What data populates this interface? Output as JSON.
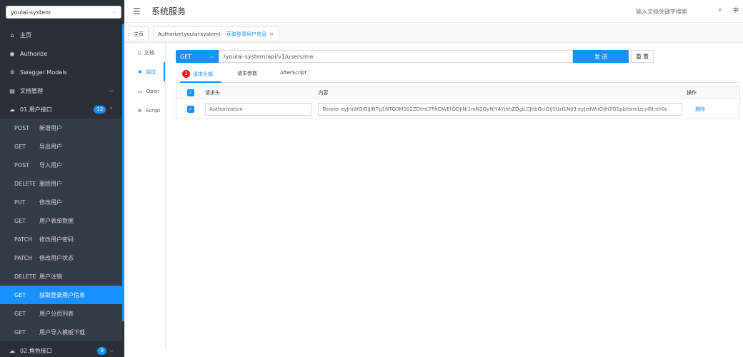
{
  "sidebar": {
    "group_select": "youlai-system",
    "menu": [
      {
        "label": "主页",
        "icon": "home-icon"
      },
      {
        "label": "Authorize",
        "icon": "lock-icon"
      },
      {
        "label": "Swagger Models",
        "icon": "gear-icon"
      },
      {
        "label": "文档管理",
        "icon": "doc-icon"
      }
    ],
    "group1": {
      "label": "01.用户接口",
      "count": "12"
    },
    "apis": [
      {
        "method": "POST",
        "name": "新增用户"
      },
      {
        "method": "GET",
        "name": "导出用户"
      },
      {
        "method": "POST",
        "name": "导入用户"
      },
      {
        "method": "DELETE",
        "name": "删除用户"
      },
      {
        "method": "PUT",
        "name": "修改用户"
      },
      {
        "method": "GET",
        "name": "用户表单数据"
      },
      {
        "method": "PATCH",
        "name": "修改用户密码"
      },
      {
        "method": "PATCH",
        "name": "修改用户状态"
      },
      {
        "method": "DELETE",
        "name": "用户注销"
      },
      {
        "method": "GET",
        "name": "获取登录用户信息"
      },
      {
        "method": "GET",
        "name": "用户分页列表"
      },
      {
        "method": "GET",
        "name": "用户导入模板下载"
      }
    ],
    "group2": {
      "label": "02.角色接口",
      "count": "9"
    }
  },
  "header": {
    "title": "系统服务",
    "search_placeholder": "输入文档关键字搜索",
    "lang": "中"
  },
  "tabs": [
    {
      "label": "主页"
    },
    {
      "label": "Authorize(youlai-system)"
    },
    {
      "label": "获取登录用户信息"
    }
  ],
  "vtabs": [
    {
      "label": "文档",
      "icon": "doc-icon"
    },
    {
      "label": "调试",
      "icon": "bug-icon"
    },
    {
      "label": "Open",
      "icon": "file-icon"
    },
    {
      "label": "Script",
      "icon": "globe-icon"
    }
  ],
  "request": {
    "method": "GET",
    "url": "/youlai-system/api/v1/users/me",
    "send": "发 送",
    "reset": "重 置"
  },
  "subtabs": [
    {
      "label": "请求头部",
      "count": "1"
    },
    {
      "label": "请求参数"
    },
    {
      "label": "AfterScript"
    }
  ],
  "table": {
    "headers": {
      "name": "请求头",
      "content": "内容",
      "op": "操作"
    },
    "row": {
      "name": "Authorization",
      "content": "Bearer eyJraWQiOiJlNTg1NTQ3MS02ZDlmLTRkOWEtODJiNi1mN2QyNjY4YjhhZDgiLCJhbGciOiJSUzI1NiJ9.eyJzdWIiOiJhZG1pbiIsImlzcyI6Imh0c",
      "op": "删除"
    }
  }
}
